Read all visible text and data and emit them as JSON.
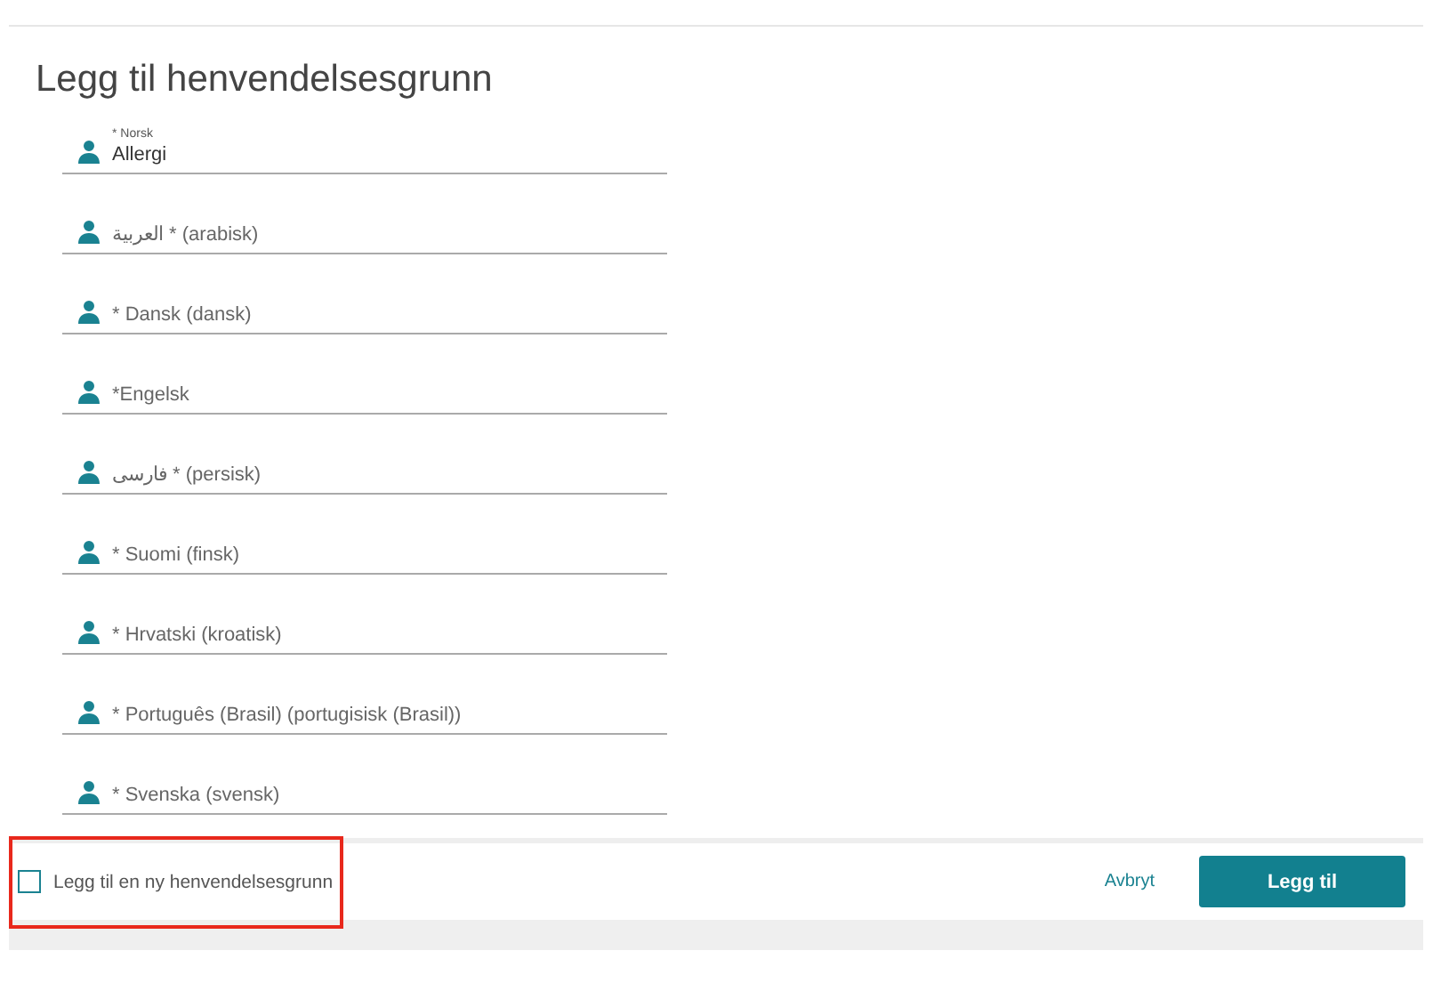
{
  "title": "Legg til henvendelsesgrunn",
  "fields": [
    {
      "label": "* Norsk",
      "value": "Allergi"
    },
    {
      "placeholder": "العربية * (arabisk)"
    },
    {
      "placeholder": "* Dansk (dansk)"
    },
    {
      "placeholder": "*Engelsk"
    },
    {
      "placeholder": "فارسی * (persisk)"
    },
    {
      "placeholder": "* Suomi (finsk)"
    },
    {
      "placeholder": "* Hrvatski (kroatisk)"
    },
    {
      "placeholder": "* Português (Brasil) (portugisisk (Brasil))"
    },
    {
      "placeholder": "* Svenska (svensk)"
    }
  ],
  "footer": {
    "checkbox": {
      "label": "Legg til en ny henvendelsesgrunn",
      "checked": false,
      "highlighted": true
    },
    "cancel": "Avbryt",
    "submit": "Legg til"
  }
}
